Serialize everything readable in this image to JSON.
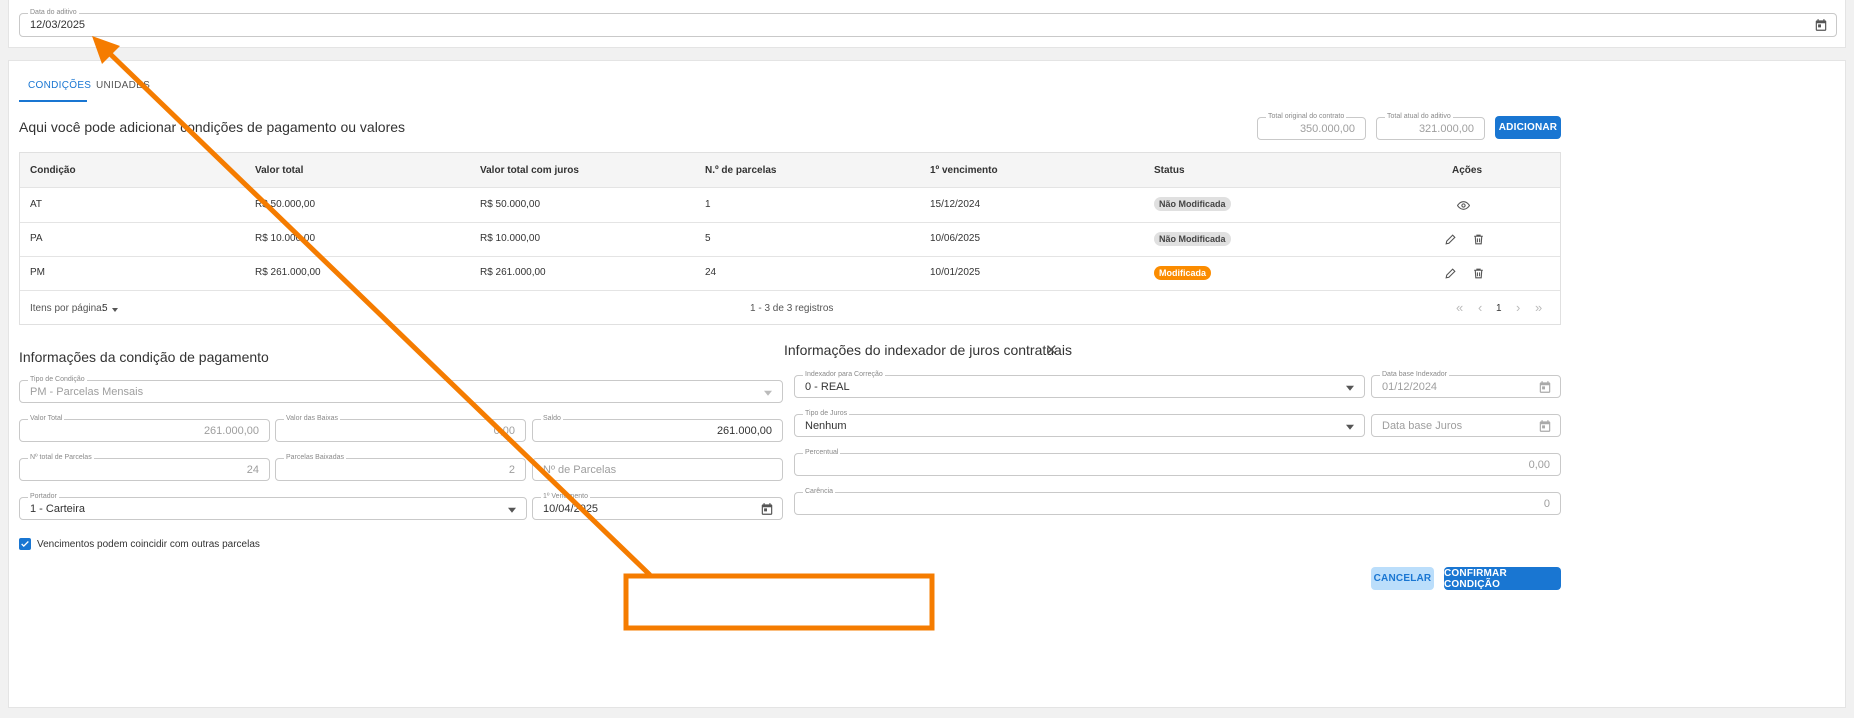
{
  "aditivo": {
    "date_label": "Data do aditivo",
    "date_value": "12/03/2025"
  },
  "tabs": [
    {
      "label": "CONDIÇÕES"
    },
    {
      "label": "UNIDADES"
    }
  ],
  "conditions": {
    "heading": "Aqui você pode adicionar condições de pagamento ou valores",
    "total_original_label": "Total original do contrato",
    "total_original_value": "350.000,00",
    "total_atual_label": "Total atual do aditivo",
    "total_atual_value": "321.000,00",
    "add_button": "ADICIONAR"
  },
  "table": {
    "columns": [
      "Condição",
      "Valor total",
      "Valor total com juros",
      "N.º de parcelas",
      "1º vencimento",
      "Status",
      "Ações"
    ],
    "rows": [
      {
        "condicao": "AT",
        "valor_total": "R$ 50.000,00",
        "valor_juros": "R$ 50.000,00",
        "parcelas": "1",
        "vencimento": "15/12/2024",
        "status": "Não Modificada"
      },
      {
        "condicao": "PA",
        "valor_total": "R$ 10.000,00",
        "valor_juros": "R$ 10.000,00",
        "parcelas": "5",
        "vencimento": "10/06/2025",
        "status": "Não Modificada"
      },
      {
        "condicao": "PM",
        "valor_total": "R$ 261.000,00",
        "valor_juros": "R$ 261.000,00",
        "parcelas": "24",
        "vencimento": "10/01/2025",
        "status": "Modificada"
      }
    ],
    "per_page_label": "Itens por página:",
    "per_page_value": "5",
    "range_text": "1 - 3 de 3 registros",
    "current_page": "1"
  },
  "payment_info": {
    "title": "Informações da condição de pagamento",
    "tipo_condicao_label": "Tipo de Condição",
    "tipo_condicao_value": "PM - Parcelas Mensais",
    "valor_total_label": "Valor Total",
    "valor_total_value": "261.000,00",
    "valor_baixas_label": "Valor das Baixas",
    "valor_baixas_value": "0,00",
    "saldo_label": "Saldo",
    "saldo_value": "261.000,00",
    "n_total_parcelas_label": "Nº total de Parcelas",
    "n_total_parcelas_value": "24",
    "parcelas_baixadas_label": "Parcelas Baixadas",
    "parcelas_baixadas_value": "2",
    "n_parcelas_placeholder": "Nº de Parcelas",
    "portador_label": "Portador",
    "portador_value": "1 - Carteira",
    "vencimento_label": "1º Vencimento",
    "vencimento_value": "10/04/2025",
    "checkbox_label": "Vencimentos podem coincidir com outras parcelas"
  },
  "indexador": {
    "title": "Informações do indexador de juros contratuais",
    "indexador_label": "Indexador para Correção",
    "indexador_value": "0 - REAL",
    "data_base_indexador_label": "Data base Indexador",
    "data_base_indexador_value": "01/12/2024",
    "tipo_juros_label": "Tipo de Juros",
    "tipo_juros_value": "Nenhum",
    "data_base_juros_placeholder": "Data base Juros",
    "percentual_label": "Percentual",
    "percentual_value": "0,00",
    "carencia_label": "Carência",
    "carencia_value": "0"
  },
  "actions": {
    "cancel": "CANCELAR",
    "confirm": "CONFIRMAR CONDIÇÃO"
  },
  "colors": {
    "primary": "#1976d2",
    "annotation": "#f57c00",
    "modified_badge": "#fb8c00",
    "unmodified_badge": "#e0e0e0",
    "cancel_bg": "#bbdefb"
  }
}
